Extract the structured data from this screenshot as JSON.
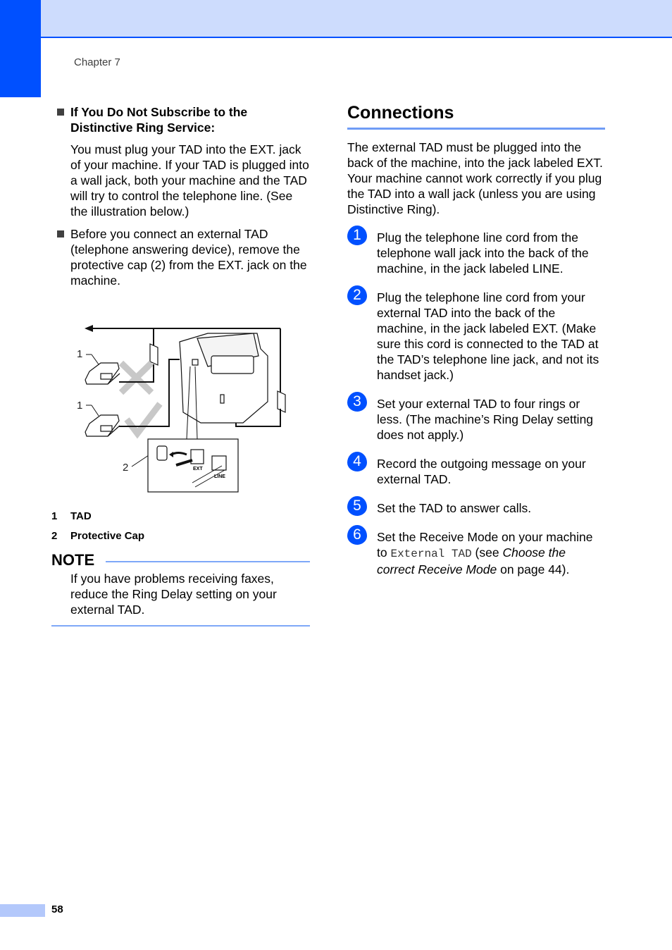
{
  "header": {
    "chapter": "Chapter 7",
    "colors": {
      "accent": "#0050ff",
      "band": "#cddcfd",
      "rule_light": "#7ea8f8"
    }
  },
  "left": {
    "bullet1": {
      "heading": "If You Do Not Subscribe to the Distinctive Ring Service:",
      "body": "You must plug your TAD into the EXT. jack of your machine. If your TAD is plugged into a wall jack, both your machine and the TAD will try to control the telephone line. (See the illustration below.)"
    },
    "bullet2": {
      "body": "Before you connect an external TAD (telephone answering device), remove the protective cap (2) from the EXT. jack on the machine."
    },
    "figure": {
      "callout_1a": "1",
      "callout_1b": "1",
      "callout_2": "2",
      "jack_ext": "EXT",
      "jack_line": "LINE",
      "wrong_mark": "cross-icon",
      "right_mark": "checkmark-icon"
    },
    "legend": [
      {
        "num": "1",
        "label": "TAD"
      },
      {
        "num": "2",
        "label": "Protective Cap"
      }
    ],
    "note": {
      "title": "NOTE",
      "body": "If you have problems receiving faxes, reduce the Ring Delay setting on your external TAD."
    }
  },
  "right": {
    "title": "Connections",
    "intro": "The external TAD must be plugged into the back of the machine, into the jack labeled EXT. Your machine cannot work correctly if you plug the TAD into a wall jack (unless you are using Distinctive Ring).",
    "steps": [
      {
        "num": "1",
        "text": "Plug the telephone line cord from the telephone wall jack into the back of the machine, in the jack labeled LINE."
      },
      {
        "num": "2",
        "text": "Plug the telephone line cord from your external TAD into the back of the machine, in the jack labeled EXT. (Make sure this cord is connected to the TAD at the TAD’s telephone line jack, and not its handset jack.)"
      },
      {
        "num": "3",
        "text": "Set your external TAD to four rings or less. (The machine’s Ring Delay setting does not apply.)"
      },
      {
        "num": "4",
        "text": "Record the outgoing message on your external TAD."
      },
      {
        "num": "5",
        "text": "Set the TAD to answer calls."
      },
      {
        "num": "6",
        "pre": "Set the Receive Mode on your machine to ",
        "code": "External TAD",
        "mid": " (see ",
        "link": "Choose the correct Receive Mode",
        "post": " on page 44)."
      }
    ]
  },
  "footer": {
    "page": "58"
  }
}
